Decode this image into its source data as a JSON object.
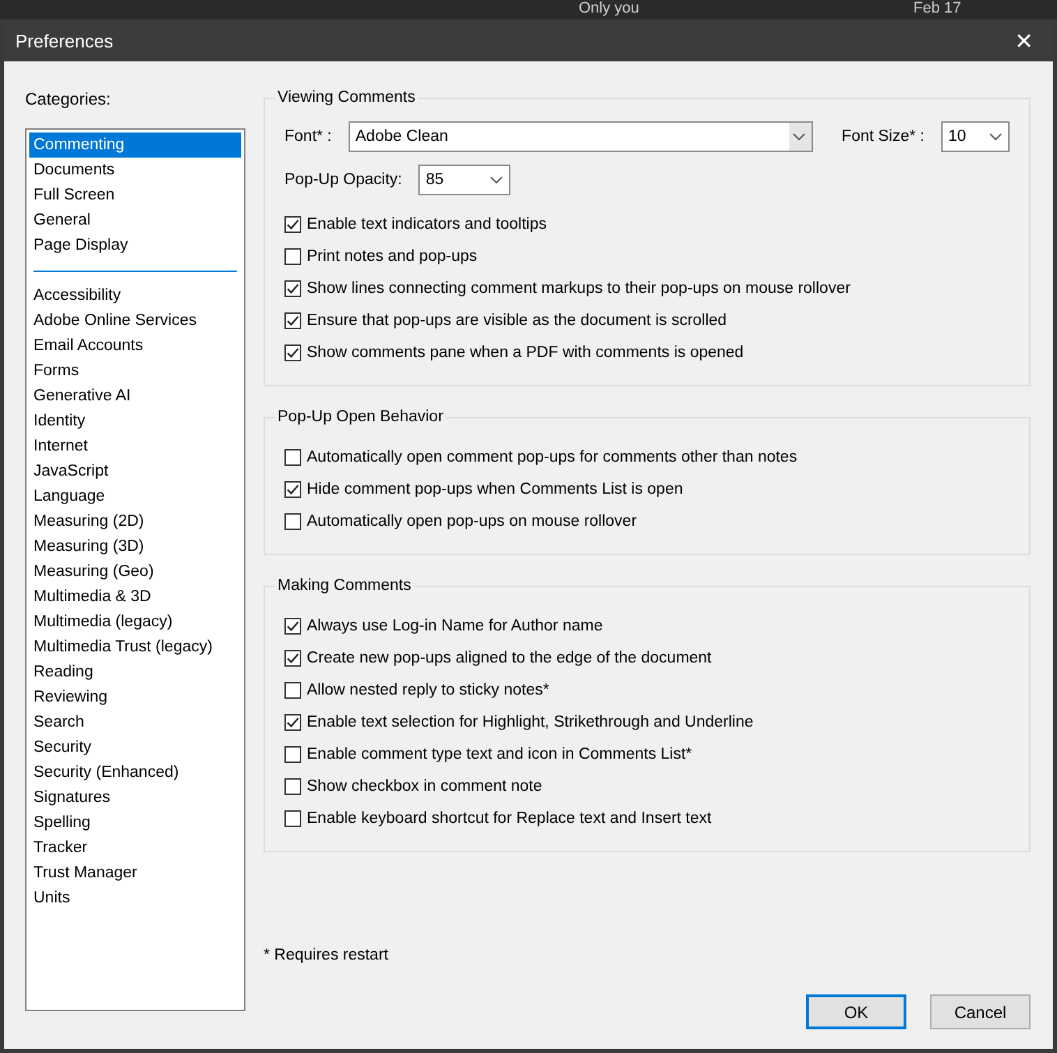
{
  "background_app": {
    "texts": [
      "Only you",
      "Feb 17"
    ]
  },
  "window": {
    "title": "Preferences",
    "close": "✕"
  },
  "categories": {
    "label": "Categories:",
    "groups": [
      [
        {
          "label": "Commenting",
          "selected": true
        },
        {
          "label": "Documents",
          "selected": false
        },
        {
          "label": "Full Screen",
          "selected": false
        },
        {
          "label": "General",
          "selected": false
        },
        {
          "label": "Page Display",
          "selected": false
        }
      ],
      [
        {
          "label": "Accessibility",
          "selected": false
        },
        {
          "label": "Adobe Online Services",
          "selected": false
        },
        {
          "label": "Email Accounts",
          "selected": false
        },
        {
          "label": "Forms",
          "selected": false
        },
        {
          "label": "Generative AI",
          "selected": false
        },
        {
          "label": "Identity",
          "selected": false
        },
        {
          "label": "Internet",
          "selected": false
        },
        {
          "label": "JavaScript",
          "selected": false
        },
        {
          "label": "Language",
          "selected": false
        },
        {
          "label": "Measuring (2D)",
          "selected": false
        },
        {
          "label": "Measuring (3D)",
          "selected": false
        },
        {
          "label": "Measuring (Geo)",
          "selected": false
        },
        {
          "label": "Multimedia & 3D",
          "selected": false
        },
        {
          "label": "Multimedia (legacy)",
          "selected": false
        },
        {
          "label": "Multimedia Trust (legacy)",
          "selected": false
        },
        {
          "label": "Reading",
          "selected": false
        },
        {
          "label": "Reviewing",
          "selected": false
        },
        {
          "label": "Search",
          "selected": false
        },
        {
          "label": "Security",
          "selected": false
        },
        {
          "label": "Security (Enhanced)",
          "selected": false
        },
        {
          "label": "Signatures",
          "selected": false
        },
        {
          "label": "Spelling",
          "selected": false
        },
        {
          "label": "Tracker",
          "selected": false
        },
        {
          "label": "Trust Manager",
          "selected": false
        },
        {
          "label": "Units",
          "selected": false
        }
      ]
    ]
  },
  "sections": [
    {
      "title": "Viewing Comments",
      "dropdown_rows": [
        [
          {
            "label": "Font* :",
            "value": "Adobe Clean"
          },
          {
            "label": "Font Size* :",
            "value": "10"
          }
        ],
        [
          {
            "label": "Pop-Up Opacity:",
            "value": "85"
          }
        ]
      ],
      "options": [
        {
          "label": "Enable text indicators and tooltips",
          "checked": true
        },
        {
          "label": "Print notes and pop-ups",
          "checked": false
        },
        {
          "label": "Show lines connecting comment markups to their pop-ups on mouse rollover",
          "checked": true
        },
        {
          "label": "Ensure that pop-ups are visible as the document is scrolled",
          "checked": true
        },
        {
          "label": "Show comments pane when a PDF with comments is opened",
          "checked": true
        }
      ]
    },
    {
      "title": "Pop-Up Open Behavior",
      "options": [
        {
          "label": "Automatically open comment pop-ups for comments other than notes",
          "checked": false
        },
        {
          "label": "Hide comment pop-ups when Comments List is open",
          "checked": true
        },
        {
          "label": "Automatically open pop-ups on mouse rollover",
          "checked": false
        }
      ]
    },
    {
      "title": "Making Comments",
      "options": [
        {
          "label": "Always use Log-in Name for Author name",
          "checked": true
        },
        {
          "label": "Create new pop-ups aligned to the edge of the document",
          "checked": true
        },
        {
          "label": "Allow nested reply to sticky notes*",
          "checked": false
        },
        {
          "label": "Enable text selection for Highlight, Strikethrough and Underline",
          "checked": true
        },
        {
          "label": "Enable comment type text and icon in Comments List*",
          "checked": false
        },
        {
          "label": "Show checkbox in comment note",
          "checked": false
        },
        {
          "label": "Enable keyboard shortcut for Replace text and Insert text",
          "checked": false
        }
      ]
    }
  ],
  "note": "* Requires restart",
  "buttons": [
    {
      "label": "OK",
      "default": true
    },
    {
      "label": "Cancel",
      "default": false
    }
  ]
}
